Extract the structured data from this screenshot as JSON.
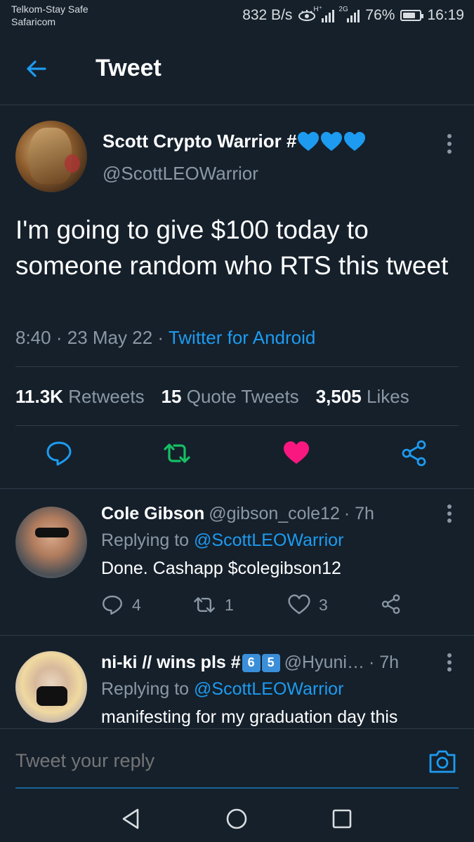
{
  "status_bar": {
    "carrier_line1": "Telkom-Stay Safe",
    "carrier_line2": "Safaricom",
    "speed": "832 B/s",
    "net1": "H⁺",
    "net2": "2G",
    "battery": "76%",
    "battery_level": 0.76,
    "time": "16:19"
  },
  "header": {
    "title": "Tweet"
  },
  "tweet": {
    "author_name": "Scott Crypto Warrior #",
    "author_emoji": "💙💙💙",
    "author_handle": "@ScottLEOWarrior",
    "text": "I'm going to give $100 today to someone random who RTS this tweet",
    "time": "8:40",
    "date": "23 May 22",
    "separator": "·",
    "source": "Twitter for Android",
    "stats": {
      "retweets_count": "11.3K",
      "retweets_label": "Retweets",
      "quotes_count": "15",
      "quotes_label": "Quote Tweets",
      "likes_count": "3,505",
      "likes_label": "Likes"
    }
  },
  "replies": [
    {
      "name": "Cole Gibson",
      "handle": "@gibson_cole12",
      "age": "· 7h",
      "replying_prefix": "Replying to",
      "replying_to": "@ScottLEOWarrior",
      "text": "Done. Cashapp $colegibson12",
      "reply_count": "4",
      "retweet_count": "1",
      "like_count": "3"
    },
    {
      "name": "ni-ki // wins pls #",
      "name_badges": [
        "6",
        "5"
      ],
      "handle": "@Hyuni…",
      "age": "· 7h",
      "replying_prefix": "Replying to",
      "replying_to": "@ScottLEOWarrior",
      "text": "manifesting for my graduation day this"
    }
  ],
  "composer": {
    "placeholder": "Tweet your reply"
  },
  "colors": {
    "background": "#15202b",
    "accent": "#1d9bf0",
    "secondary_text": "#8b98a5",
    "retweet_green": "#17bf63",
    "like_red": "#f91880",
    "divider": "#2f3b47"
  },
  "icons": {
    "back": "arrow-left-icon",
    "more": "vertical-dots-icon",
    "reply": "speech-bubble-icon",
    "retweet": "retweet-arrows-icon",
    "like": "heart-icon",
    "share": "share-nodes-icon",
    "camera": "camera-icon",
    "nav_back": "triangle-back-icon",
    "nav_home": "circle-home-icon",
    "nav_recents": "square-recents-icon"
  }
}
